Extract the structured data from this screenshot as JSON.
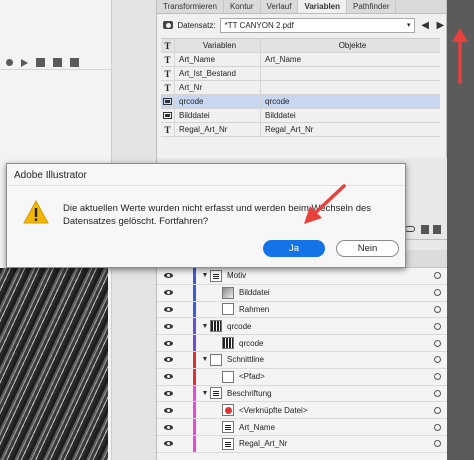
{
  "panel_tabs": [
    "Transformieren",
    "Kontur",
    "Verlauf",
    "Variablen",
    "Pathfinder"
  ],
  "active_tab_index": 3,
  "dataset": {
    "label": "Datensatz:",
    "value": "*TT CANYON 2.pdf",
    "prev": "◀",
    "next": "▶"
  },
  "variables_table": {
    "col_type": "T",
    "col_name": "Variablen",
    "col_object": "Objekte",
    "rows": [
      {
        "type": "text",
        "type_glyph": "T",
        "name": "Art_Name",
        "object": "Art_Name",
        "selected": false
      },
      {
        "type": "text",
        "type_glyph": "T",
        "name": "Art_Ist_Bestand",
        "object": "",
        "selected": false
      },
      {
        "type": "text",
        "type_glyph": "T",
        "name": "Art_Nr",
        "object": "",
        "selected": false
      },
      {
        "type": "image",
        "type_glyph": "",
        "name": "qrcode",
        "object": "qrcode",
        "selected": true
      },
      {
        "type": "image",
        "type_glyph": "",
        "name": "Bilddatei",
        "object": "Bilddatei",
        "selected": false
      },
      {
        "type": "text",
        "type_glyph": "T",
        "name": "Regal_Art_Nr",
        "object": "Regal_Art_Nr",
        "selected": false
      }
    ]
  },
  "dialog": {
    "title": "Adobe Illustrator",
    "message": "Die aktuellen Werte wurden nicht erfasst und werden beim Wechseln des Datensatzes gelöscht. Fortfahren?",
    "yes_label": "Ja",
    "no_label": "Nein"
  },
  "layers": [
    {
      "name": "Motiv",
      "indent": 0,
      "expandable": true,
      "thumb": "txt",
      "bar_color": "#3b5bdb"
    },
    {
      "name": "Bilddatei",
      "indent": 1,
      "expandable": false,
      "thumb": "img",
      "bar_color": "#3b5bdb"
    },
    {
      "name": "Rahmen",
      "indent": 1,
      "expandable": false,
      "thumb": "blank",
      "bar_color": "#3b5bdb"
    },
    {
      "name": "qrcode",
      "indent": 0,
      "expandable": true,
      "thumb": "qr",
      "bar_color": "#6b4fd8"
    },
    {
      "name": "qrcode",
      "indent": 1,
      "expandable": false,
      "thumb": "qr",
      "bar_color": "#6b4fd8"
    },
    {
      "name": "Schnittline",
      "indent": 0,
      "expandable": true,
      "thumb": "blank",
      "bar_color": "#e03131"
    },
    {
      "name": "<Pfad>",
      "indent": 1,
      "expandable": false,
      "thumb": "blank",
      "bar_color": "#e03131"
    },
    {
      "name": "Beschriftung",
      "indent": 0,
      "expandable": true,
      "thumb": "txt",
      "bar_color": "#e64bd6"
    },
    {
      "name": "<Verknüpfte Datei>",
      "indent": 1,
      "expandable": false,
      "thumb": "red",
      "bar_color": "#e64bd6"
    },
    {
      "name": "Art_Name",
      "indent": 1,
      "expandable": false,
      "thumb": "txt",
      "bar_color": "#e64bd6"
    },
    {
      "name": "Regal_Art_Nr",
      "indent": 1,
      "expandable": false,
      "thumb": "txt",
      "bar_color": "#e64bd6"
    }
  ],
  "colors": {
    "accent": "#1473e6",
    "annotation_arrow": "#e8413c",
    "selection": "#c7d7f2"
  }
}
